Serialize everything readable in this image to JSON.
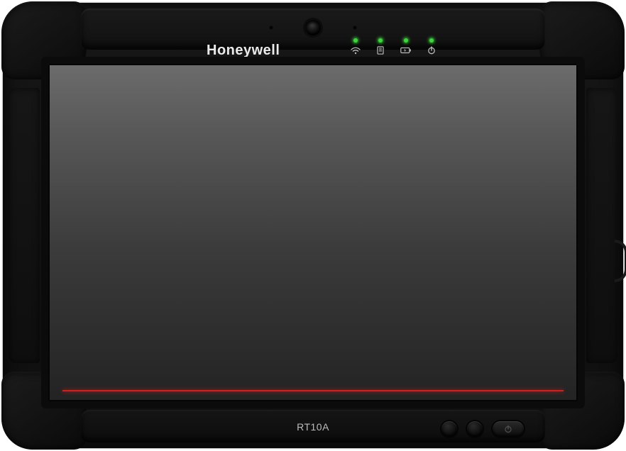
{
  "brand": "Honeywell",
  "model": "RT10A",
  "status_leds": {
    "wifi": "on",
    "storage": "on",
    "battery": "on",
    "power": "on"
  },
  "colors": {
    "led_green": "#3bd63b",
    "accent_red": "#d11f1f",
    "bezel": "#121212"
  }
}
